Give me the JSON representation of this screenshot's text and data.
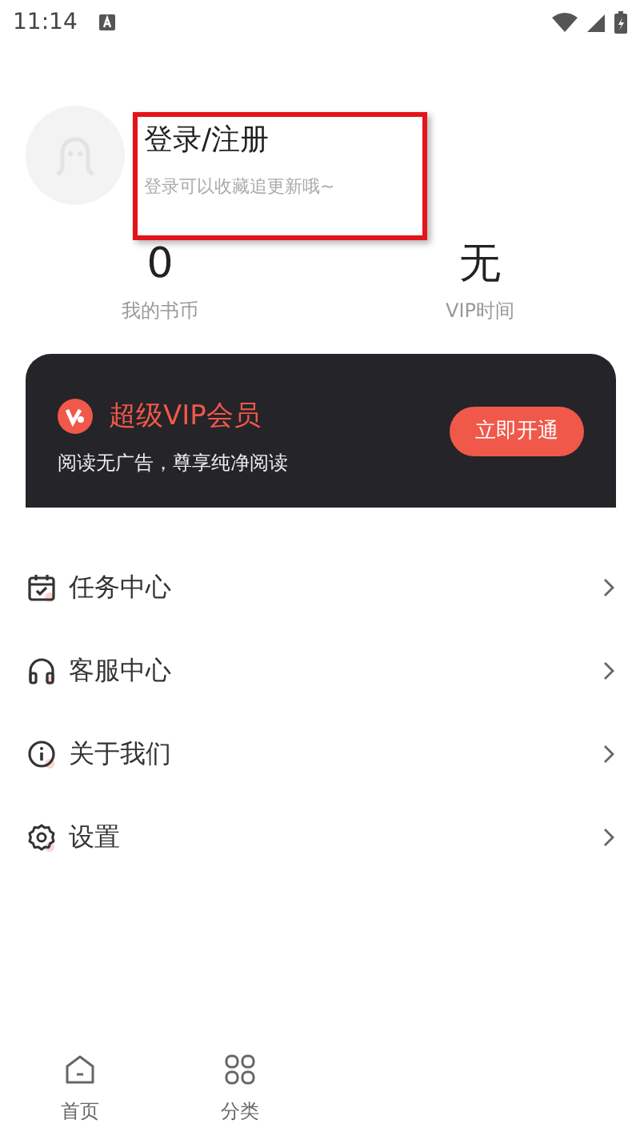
{
  "status_bar": {
    "time": "11:14"
  },
  "profile": {
    "title": "登录/注册",
    "subtitle": "登录可以收藏追更新哦~"
  },
  "stats": [
    {
      "value": "0",
      "label": "我的书币"
    },
    {
      "value": "无",
      "label": "VIP时间"
    }
  ],
  "vip_card": {
    "title": "超级VIP会员",
    "subtitle": "阅读无广告，尊享纯净阅读",
    "button": "立即开通"
  },
  "menu": [
    {
      "kind": "tasks",
      "label": "任务中心"
    },
    {
      "kind": "support",
      "label": "客服中心"
    },
    {
      "kind": "about",
      "label": "关于我们"
    },
    {
      "kind": "settings",
      "label": "设置"
    }
  ],
  "tab_bar": [
    {
      "kind": "home",
      "label": "首页",
      "selected": false
    },
    {
      "kind": "category",
      "label": "分类",
      "selected": false
    }
  ]
}
